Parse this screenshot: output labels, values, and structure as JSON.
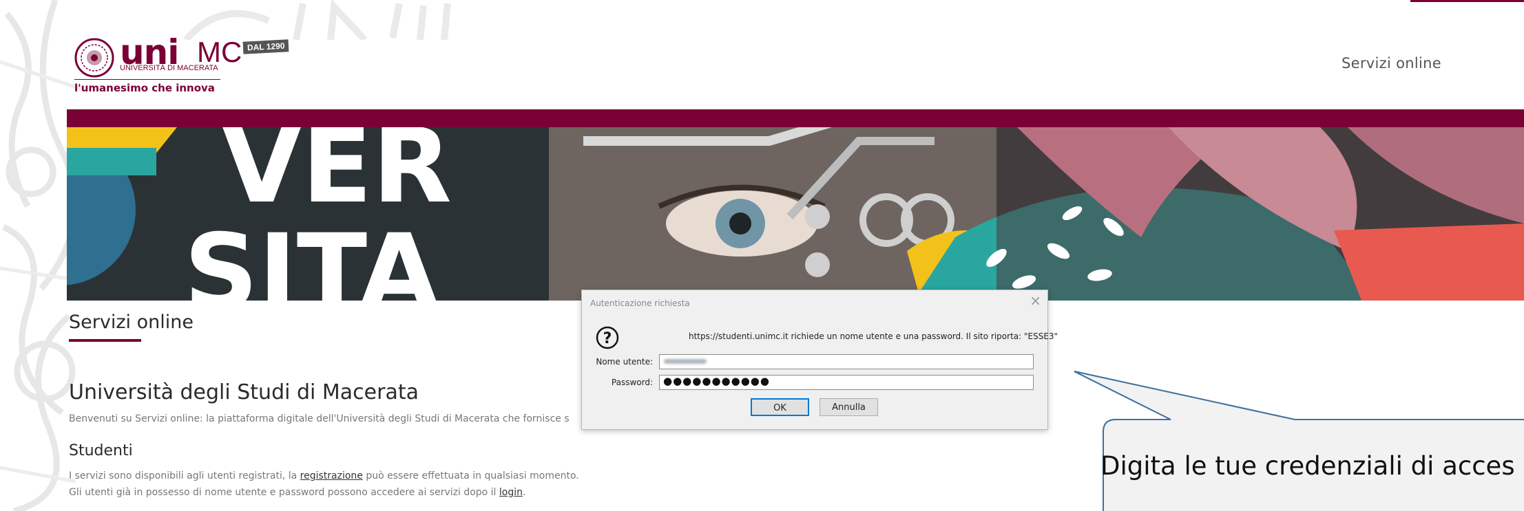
{
  "header": {
    "logo_uni": "uni",
    "logo_mc": "MC",
    "logo_subtitle": "UNIVERSITÀ DI MACERATA",
    "logo_badge": "DAL 1290",
    "tagline": "l'umanesimo che innova",
    "nav_link": "Servizi online"
  },
  "banner": {
    "letters_top": "VER",
    "letters_bottom": "SITA"
  },
  "main": {
    "page_title": "Servizi online",
    "university_title": "Università degli Studi di Macerata",
    "welcome_text": "Benvenuti su Servizi online: la piattaforma digitale dell'Università degli Studi di Macerata che fornisce s",
    "students_heading": "Studenti",
    "line1_before": "I servizi sono disponibili agli utenti registrati, la ",
    "line1_link": "registrazione",
    "line1_after": " può essere effettuata in qualsiasi momento.",
    "line2_before": "Gli utenti già in possesso di nome utente e password possono accedere ai servizi dopo il ",
    "line2_link": "login",
    "line2_after": "."
  },
  "dialog": {
    "title": "Autenticazione richiesta",
    "close_glyph": "×",
    "icon_glyph": "?",
    "message": "https://studenti.unimc.it richiede un nome utente e una password. Il sito riporta: \"ESSE3\"",
    "username_label": "Nome utente:",
    "password_label": "Password:",
    "password_value": "●●●●●●●●●●●",
    "ok_label": "OK",
    "cancel_label": "Annulla"
  },
  "callout": {
    "text": "Digita le tue credenziali di acces"
  },
  "colors": {
    "brand": "#7a0035",
    "dialog_bg": "#f0f0f0",
    "focus_border": "#0078d7",
    "callout_border": "#41719c"
  }
}
